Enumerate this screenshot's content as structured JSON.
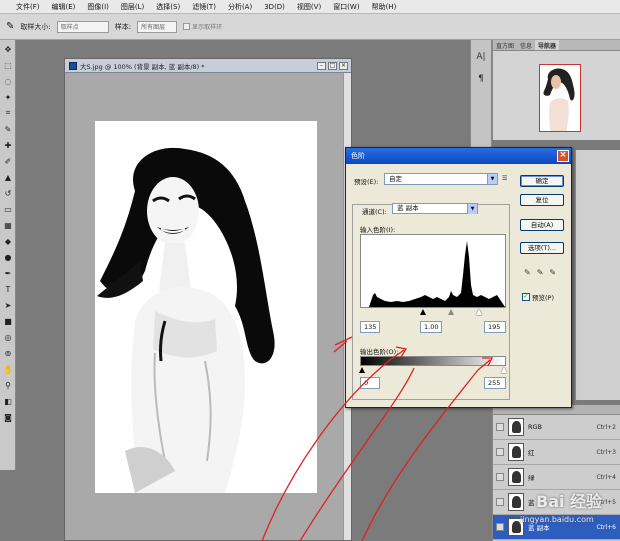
{
  "menubar": {
    "items": [
      "文件(F)",
      "编辑(E)",
      "图像(I)",
      "图层(L)",
      "选择(S)",
      "滤镜(T)",
      "分析(A)",
      "3D(D)",
      "视图(V)",
      "窗口(W)",
      "帮助(H)"
    ]
  },
  "options": {
    "sample_size_label": "取样大小:",
    "sample_size_value": "取样点",
    "sample_label": "样本:",
    "sample_value": "所有图层",
    "show_ring_label": "显示取样环"
  },
  "document": {
    "title": "大S.jpg @ 100% (背景 副本, 蓝 副本/8) *"
  },
  "navigator": {
    "tabs": [
      "直方图",
      "信息",
      "导航器"
    ]
  },
  "levels": {
    "title": "色阶",
    "preset_label": "预设(E):",
    "preset_value": "自定",
    "channel_label": "通道(C):",
    "channel_value": "蓝 副本",
    "input_label": "输入色阶(I):",
    "input_black": "135",
    "input_gamma": "1.00",
    "input_white": "195",
    "output_label": "输出色阶(O):",
    "output_black": "0",
    "output_white": "255",
    "buttons": {
      "ok": "确定",
      "reset": "复位",
      "auto": "自动(A)",
      "options": "选项(T)..."
    },
    "preview_label": "预览(P)"
  },
  "layers": {
    "rows": [
      {
        "name": "RGB",
        "shortcut": "Ctrl+2"
      },
      {
        "name": "红",
        "shortcut": "Ctrl+3"
      },
      {
        "name": "绿",
        "shortcut": "Ctrl+4"
      },
      {
        "name": "蓝",
        "shortcut": "Ctrl+5"
      },
      {
        "name": "蓝 副本",
        "shortcut": "Ctrl+6"
      }
    ]
  },
  "watermark": {
    "brand": "Bai 经验",
    "url": "jingyan.baidu.com"
  }
}
